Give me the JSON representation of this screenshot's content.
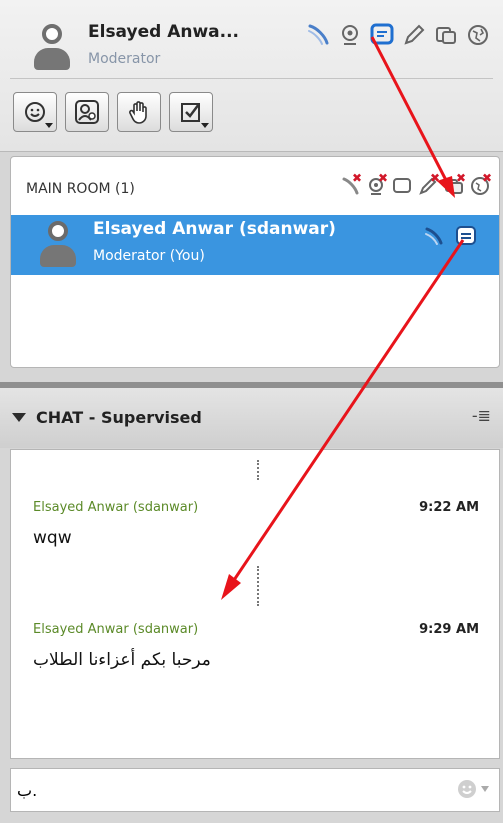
{
  "profile": {
    "name": "Elsayed Anwa...",
    "role": "Moderator",
    "status_icons": [
      "microphone-icon",
      "webcam-icon",
      "chat-icon",
      "pencil-icon",
      "screen-share-icon",
      "globe-icon"
    ],
    "tools": [
      "status-emoticon-icon",
      "settings-user-icon",
      "raise-hand-icon",
      "poll-checkbox-icon"
    ]
  },
  "room": {
    "title": "MAIN ROOM (1)",
    "column_icons": [
      "microphone-icon",
      "webcam-icon",
      "chat-icon",
      "pencil-icon",
      "screen-share-icon",
      "globe-icon"
    ],
    "participants": [
      {
        "name": "Elsayed Anwar (sdanwar)",
        "role": "Moderator (You)",
        "icons": [
          "microphone-icon",
          "chat-icon"
        ]
      }
    ]
  },
  "chat": {
    "title": "CHAT - Supervised",
    "messages": [
      {
        "sender": "Elsayed Anwar (sdanwar)",
        "time": "9:22 AM",
        "text": "wqw"
      },
      {
        "sender": "Elsayed Anwar (sdanwar)",
        "time": "9:29 AM",
        "text": "مرحبا بكم أعزاءنا الطلاب"
      }
    ],
    "input_value": "ب."
  },
  "colors": {
    "selection": "#3a95e0",
    "sender_green": "#5b8a28",
    "annotation_red": "#e8141b",
    "role_gray": "#8795a8"
  }
}
